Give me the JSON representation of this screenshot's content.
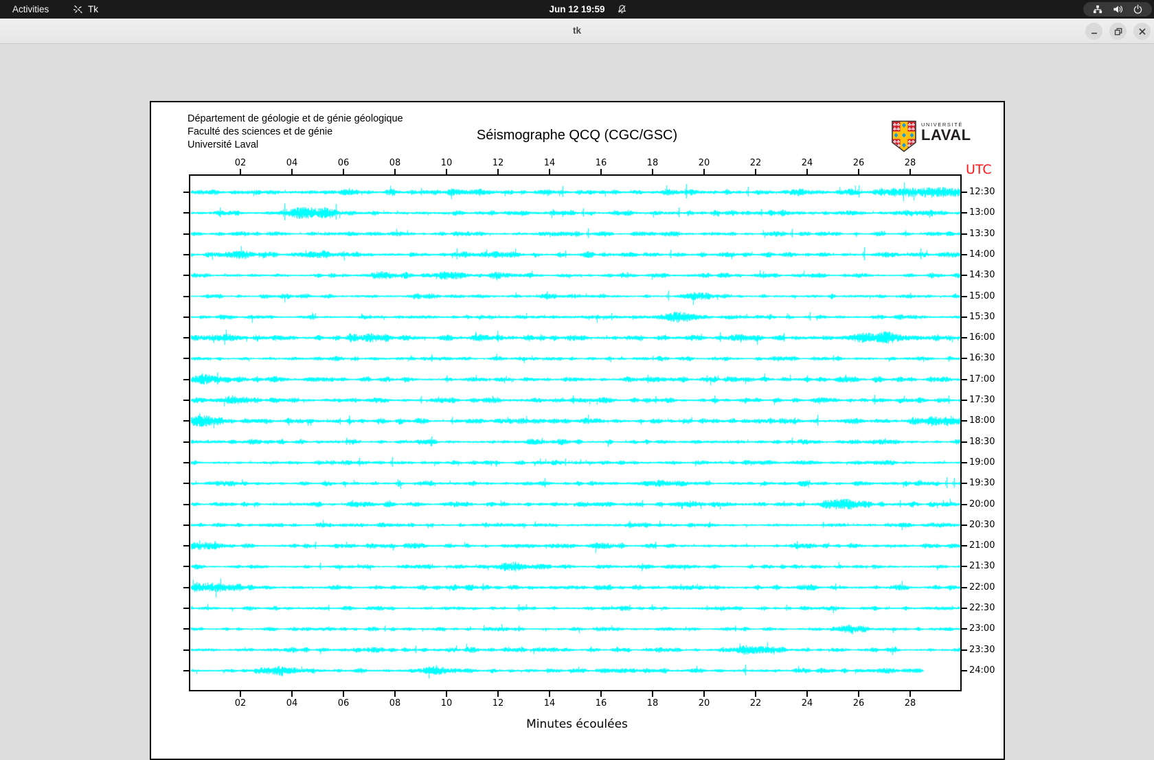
{
  "top_bar": {
    "activities_label": "Activities",
    "app_menu_label": "Tk",
    "clock": "Jun 12 19:59",
    "icons": [
      "tk-icon",
      "notifications-muted-icon",
      "network-wired-icon",
      "volume-icon",
      "power-icon"
    ]
  },
  "window": {
    "title": "tk",
    "buttons": [
      "minimize",
      "maximize",
      "close"
    ]
  },
  "header": {
    "line1": "Département de géologie et de génie géologique",
    "line2": "Faculté des sciences et de génie",
    "line3": "Université Laval"
  },
  "logo": {
    "small_text": "UNIVERSITÉ",
    "large_text": "LAVAL",
    "shield_red": "#d32230",
    "shield_gold": "#ffc20e",
    "shield_blue": "#1e9ad6"
  },
  "chart_data": {
    "type": "line",
    "title": "Séismographe QCQ (CGC/GSC)",
    "xlabel": "Minutes écoulées",
    "utc_label": "UTC",
    "trace_color": "#00ffff",
    "x_range_minutes": [
      0,
      30
    ],
    "x_tick_labels": [
      "02",
      "04",
      "06",
      "08",
      "10",
      "12",
      "14",
      "16",
      "18",
      "20",
      "22",
      "24",
      "26",
      "28"
    ],
    "x_tick_minutes": [
      2,
      4,
      6,
      8,
      10,
      12,
      14,
      16,
      18,
      20,
      22,
      24,
      26,
      28
    ],
    "rows": [
      {
        "label": "12:30",
        "seed": 11,
        "amp": 2.2,
        "end": 1.0,
        "spikes": [
          [
            9.0,
            6
          ],
          [
            14.5,
            9
          ],
          [
            19.3,
            12
          ],
          [
            21.7,
            8
          ],
          [
            26.0,
            10
          ]
        ],
        "bursts": [
          [
            10.8,
            0.4,
            2
          ],
          [
            28.8,
            1.2,
            3.5
          ]
        ]
      },
      {
        "label": "13:00",
        "seed": 22,
        "amp": 2.2,
        "end": 1.0,
        "spikes": [
          [
            1.2,
            8
          ],
          [
            3.7,
            14
          ],
          [
            5.7,
            13
          ],
          [
            15.3,
            7
          ],
          [
            19.0,
            8
          ],
          [
            22.2,
            6
          ]
        ],
        "bursts": [
          [
            4.2,
            0.4,
            3
          ],
          [
            5.2,
            0.5,
            4
          ]
        ]
      },
      {
        "label": "13:30",
        "seed": 33,
        "amp": 1.7,
        "end": 1.0,
        "spikes": [
          [
            15.5,
            8
          ],
          [
            23.4,
            7
          ],
          [
            27.8,
            5
          ]
        ],
        "bursts": []
      },
      {
        "label": "14:00",
        "seed": 44,
        "amp": 2.0,
        "end": 1.0,
        "spikes": [
          [
            10.4,
            9
          ],
          [
            14.6,
            6
          ],
          [
            18.7,
            7
          ],
          [
            26.2,
            11
          ],
          [
            28.4,
            9
          ]
        ],
        "bursts": [
          [
            2.0,
            0.5,
            2.5
          ],
          [
            5.0,
            0.4,
            2.5
          ],
          [
            12.0,
            0.4,
            2
          ]
        ]
      },
      {
        "label": "14:30",
        "seed": 55,
        "amp": 1.8,
        "end": 1.0,
        "spikes": [
          [
            17.0,
            5
          ],
          [
            22.3,
            6
          ]
        ],
        "bursts": [
          [
            7.6,
            0.5,
            2.5
          ],
          [
            10.1,
            0.4,
            2.5
          ],
          [
            12.2,
            0.3,
            2
          ]
        ]
      },
      {
        "label": "15:00",
        "seed": 66,
        "amp": 1.8,
        "end": 1.0,
        "spikes": [
          [
            13.9,
            7
          ],
          [
            18.6,
            8
          ],
          [
            19.6,
            6
          ],
          [
            28.0,
            5
          ]
        ],
        "bursts": [
          [
            20.0,
            0.4,
            2
          ]
        ]
      },
      {
        "label": "15:30",
        "seed": 77,
        "amp": 1.8,
        "end": 1.0,
        "spikes": [
          [
            16.4,
            6
          ],
          [
            24.1,
            7
          ]
        ],
        "bursts": [
          [
            19.0,
            0.5,
            5
          ]
        ]
      },
      {
        "label": "16:00",
        "seed": 88,
        "amp": 2.4,
        "end": 1.0,
        "spikes": [
          [
            20.6,
            8
          ],
          [
            23.1,
            7
          ]
        ],
        "bursts": [
          [
            1.3,
            0.5,
            2.5
          ],
          [
            7.0,
            0.5,
            2
          ],
          [
            27.0,
            0.8,
            3
          ]
        ]
      },
      {
        "label": "16:30",
        "seed": 99,
        "amp": 1.6,
        "end": 1.0,
        "spikes": [
          [
            9.4,
            6
          ],
          [
            18.0,
            4
          ],
          [
            25.0,
            5
          ]
        ],
        "bursts": []
      },
      {
        "label": "17:00",
        "seed": 110,
        "amp": 2.0,
        "end": 1.0,
        "spikes": [
          [
            0.5,
            9
          ],
          [
            1.1,
            10
          ],
          [
            10.0,
            6
          ],
          [
            17.8,
            7
          ],
          [
            20.1,
            6
          ],
          [
            24.0,
            6
          ]
        ],
        "bursts": [
          [
            0.8,
            0.6,
            3
          ]
        ]
      },
      {
        "label": "17:30",
        "seed": 121,
        "amp": 2.0,
        "end": 1.0,
        "spikes": [
          [
            9.0,
            6
          ],
          [
            14.9,
            7
          ],
          [
            18.1,
            6
          ],
          [
            20.4,
            7
          ],
          [
            26.6,
            8
          ],
          [
            29.5,
            7
          ]
        ],
        "bursts": [
          [
            1.8,
            0.5,
            3.5
          ]
        ]
      },
      {
        "label": "18:00",
        "seed": 132,
        "amp": 2.1,
        "end": 1.0,
        "spikes": [
          [
            0.4,
            11
          ],
          [
            6.2,
            8
          ],
          [
            10.2,
            6
          ],
          [
            24.4,
            9
          ]
        ],
        "bursts": [
          [
            0.4,
            0.5,
            4
          ],
          [
            29.3,
            0.8,
            3
          ]
        ]
      },
      {
        "label": "18:30",
        "seed": 143,
        "amp": 1.9,
        "end": 1.0,
        "spikes": [
          [
            6.1,
            6
          ],
          [
            9.4,
            8
          ],
          [
            23.4,
            6
          ],
          [
            27.0,
            5
          ]
        ],
        "bursts": []
      },
      {
        "label": "19:00",
        "seed": 154,
        "amp": 1.7,
        "end": 1.0,
        "spikes": [
          [
            6.6,
            7
          ],
          [
            7.9,
            8
          ],
          [
            14.6,
            6
          ]
        ],
        "bursts": []
      },
      {
        "label": "19:30",
        "seed": 165,
        "amp": 1.9,
        "end": 1.0,
        "spikes": [
          [
            8.1,
            6
          ],
          [
            13.8,
            8
          ],
          [
            29.4,
            9
          ],
          [
            29.7,
            8
          ]
        ],
        "bursts": [
          [
            18.5,
            0.6,
            2
          ]
        ]
      },
      {
        "label": "20:00",
        "seed": 176,
        "amp": 2.1,
        "end": 1.0,
        "spikes": [
          [
            17.6,
            6
          ],
          [
            23.1,
            5
          ],
          [
            27.6,
            6
          ]
        ],
        "bursts": [
          [
            25.2,
            0.5,
            4
          ]
        ]
      },
      {
        "label": "20:30",
        "seed": 187,
        "amp": 1.7,
        "end": 1.0,
        "spikes": [
          [
            17.1,
            6
          ],
          [
            20.2,
            5
          ],
          [
            24.6,
            5
          ]
        ],
        "bursts": []
      },
      {
        "label": "21:00",
        "seed": 198,
        "amp": 1.9,
        "end": 1.0,
        "spikes": [
          [
            0.4,
            8
          ],
          [
            1.0,
            7
          ],
          [
            4.9,
            6
          ],
          [
            18.1,
            6
          ],
          [
            23.6,
            7
          ]
        ],
        "bursts": [
          [
            0.6,
            0.5,
            3
          ]
        ]
      },
      {
        "label": "21:30",
        "seed": 209,
        "amp": 1.6,
        "end": 1.0,
        "spikes": [
          [
            5.1,
            6
          ],
          [
            17.6,
            5
          ]
        ],
        "bursts": [
          [
            12.6,
            0.4,
            3
          ]
        ]
      },
      {
        "label": "22:00",
        "seed": 220,
        "amp": 2.0,
        "end": 1.0,
        "spikes": [
          [
            0.3,
            8
          ],
          [
            0.9,
            7
          ],
          [
            11.4,
            6
          ],
          [
            19.1,
            5
          ],
          [
            25.1,
            6
          ]
        ],
        "bursts": [
          [
            1.0,
            0.8,
            3
          ]
        ]
      },
      {
        "label": "22:30",
        "seed": 231,
        "amp": 1.6,
        "end": 1.0,
        "spikes": [
          [
            5.4,
            5
          ],
          [
            12.8,
            6
          ],
          [
            17.1,
            5
          ],
          [
            20.1,
            4
          ],
          [
            23.2,
            5
          ]
        ],
        "bursts": []
      },
      {
        "label": "23:00",
        "seed": 242,
        "amp": 1.5,
        "end": 1.0,
        "spikes": [
          [
            7.6,
            5
          ],
          [
            12.8,
            5
          ],
          [
            21.2,
            5
          ]
        ],
        "bursts": [
          [
            25.8,
            0.5,
            2.5
          ]
        ]
      },
      {
        "label": "23:30",
        "seed": 253,
        "amp": 1.8,
        "end": 1.0,
        "spikes": [
          [
            8.8,
            6
          ],
          [
            12.9,
            5
          ],
          [
            15.6,
            5
          ],
          [
            27.4,
            5
          ]
        ],
        "bursts": [
          [
            22.1,
            0.5,
            3.5
          ]
        ]
      },
      {
        "label": "24:00",
        "seed": 264,
        "amp": 1.8,
        "end": 0.953,
        "spikes": [
          [
            9.6,
            8
          ],
          [
            21.6,
            9
          ]
        ],
        "bursts": [
          [
            3.6,
            0.6,
            3
          ],
          [
            9.5,
            0.5,
            3
          ]
        ]
      }
    ]
  }
}
